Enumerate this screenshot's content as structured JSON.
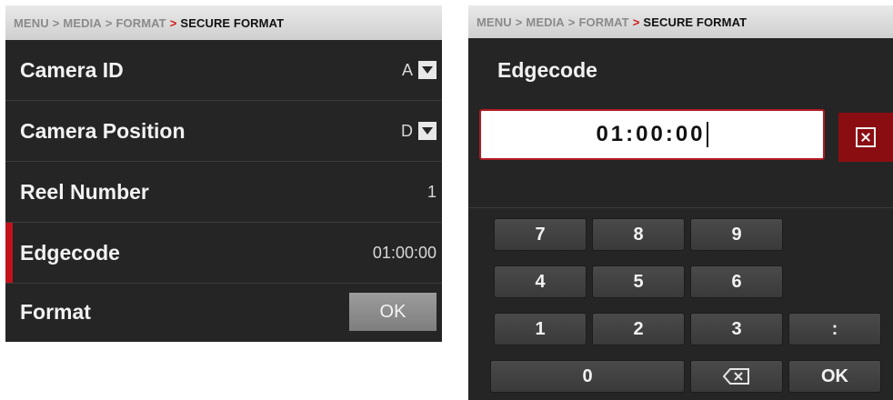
{
  "left_panel": {
    "breadcrumb": {
      "items": [
        "MENU",
        "MEDIA",
        "FORMAT"
      ],
      "separator": ">",
      "arrow": ">",
      "current": "SECURE FORMAT"
    },
    "rows": [
      {
        "label": "Camera ID",
        "value": "A"
      },
      {
        "label": "Camera Position",
        "value": "D"
      },
      {
        "label": "Reel Number",
        "value": "1"
      },
      {
        "label": "Edgecode",
        "value": "01:00:00"
      },
      {
        "label": "Format",
        "button": "OK"
      }
    ]
  },
  "right_panel": {
    "breadcrumb": {
      "items": [
        "MENU",
        "MEDIA",
        "FORMAT"
      ],
      "separator": ">",
      "arrow": ">",
      "current": "SECURE FORMAT"
    },
    "title": "Edgecode",
    "input_value": "01:00:00",
    "clear_icon": "clear-x-icon",
    "keypad": {
      "keys": [
        "7",
        "8",
        "9",
        "4",
        "5",
        "6",
        "1",
        "2",
        "3",
        ":",
        "0",
        "OK"
      ],
      "backspace_icon": "backspace-icon"
    }
  },
  "colors": {
    "accent": "#c2121c",
    "background": "#252525",
    "crumb": "#dcdcdc"
  }
}
